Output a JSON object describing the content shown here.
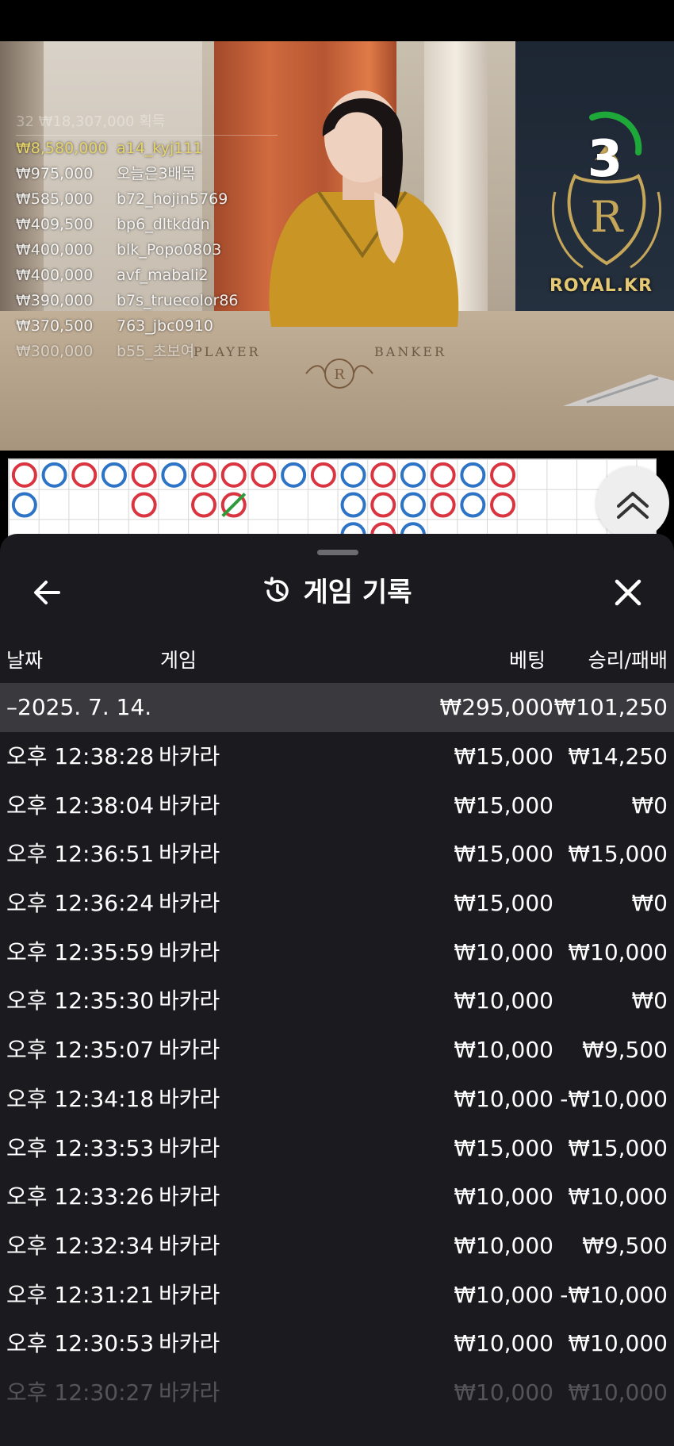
{
  "video": {
    "felt_player": "PLAYER",
    "felt_banker": "BANKER",
    "brand": "ROYAL.KR",
    "timer": "3",
    "winners_header": "32 ₩18,307,000 획득",
    "winners": [
      {
        "amount": "₩8,580,000",
        "user": "a14_kyj111"
      },
      {
        "amount": "₩975,000",
        "user": "오늘은3배목"
      },
      {
        "amount": "₩585,000",
        "user": "b72_hojin5769"
      },
      {
        "amount": "₩409,500",
        "user": "bp6_dltkddn"
      },
      {
        "amount": "₩400,000",
        "user": "blk_Popo0803"
      },
      {
        "amount": "₩400,000",
        "user": "avf_mabali2"
      },
      {
        "amount": "₩390,000",
        "user": "b7s_truecolor86"
      },
      {
        "amount": "₩370,500",
        "user": "763_jbc0910"
      },
      {
        "amount": "₩300,000",
        "user": "b55_초보여"
      }
    ]
  },
  "road": {
    "colors": {
      "banker": "#d9343f",
      "player": "#2d74c6",
      "tie": "#2d9a3c"
    },
    "columns": [
      [
        "B",
        "P"
      ],
      [
        "P"
      ],
      [
        "B"
      ],
      [
        "P"
      ],
      [
        "B",
        "B"
      ],
      [
        "P"
      ],
      [
        "B",
        "B"
      ],
      [
        "B",
        "T"
      ],
      [
        "B"
      ],
      [
        "P"
      ],
      [
        "B"
      ],
      [
        "P",
        "P",
        "P"
      ],
      [
        "B",
        "B",
        "B"
      ],
      [
        "P",
        "P",
        "P"
      ],
      [
        "B",
        "B"
      ],
      [
        "P",
        "P"
      ],
      [
        "B",
        "B"
      ]
    ]
  },
  "sheet": {
    "title": "게임 기록",
    "columns": {
      "date": "날짜",
      "game": "게임",
      "bet": "베팅",
      "result": "승리/패배"
    },
    "date_group": {
      "label": "–2025. 7. 14.",
      "bet": "₩295,000",
      "result": "₩101,250"
    },
    "rows": [
      {
        "time": "오후 12:38:28",
        "game": "바카라",
        "bet": "₩15,000",
        "result": "₩14,250"
      },
      {
        "time": "오후 12:38:04",
        "game": "바카라",
        "bet": "₩15,000",
        "result": "₩0"
      },
      {
        "time": "오후 12:36:51",
        "game": "바카라",
        "bet": "₩15,000",
        "result": "₩15,000"
      },
      {
        "time": "오후 12:36:24",
        "game": "바카라",
        "bet": "₩15,000",
        "result": "₩0"
      },
      {
        "time": "오후 12:35:59",
        "game": "바카라",
        "bet": "₩10,000",
        "result": "₩10,000"
      },
      {
        "time": "오후 12:35:30",
        "game": "바카라",
        "bet": "₩10,000",
        "result": "₩0"
      },
      {
        "time": "오후 12:35:07",
        "game": "바카라",
        "bet": "₩10,000",
        "result": "₩9,500"
      },
      {
        "time": "오후 12:34:18",
        "game": "바카라",
        "bet": "₩10,000",
        "result": "-₩10,000"
      },
      {
        "time": "오후 12:33:53",
        "game": "바카라",
        "bet": "₩15,000",
        "result": "₩15,000"
      },
      {
        "time": "오후 12:33:26",
        "game": "바카라",
        "bet": "₩10,000",
        "result": "₩10,000"
      },
      {
        "time": "오후 12:32:34",
        "game": "바카라",
        "bet": "₩10,000",
        "result": "₩9,500"
      },
      {
        "time": "오후 12:31:21",
        "game": "바카라",
        "bet": "₩10,000",
        "result": "-₩10,000"
      },
      {
        "time": "오후 12:30:53",
        "game": "바카라",
        "bet": "₩10,000",
        "result": "₩10,000"
      },
      {
        "time": "오후 12:30:27",
        "game": "바카라",
        "bet": "₩10,000",
        "result": "₩10,000"
      }
    ]
  }
}
